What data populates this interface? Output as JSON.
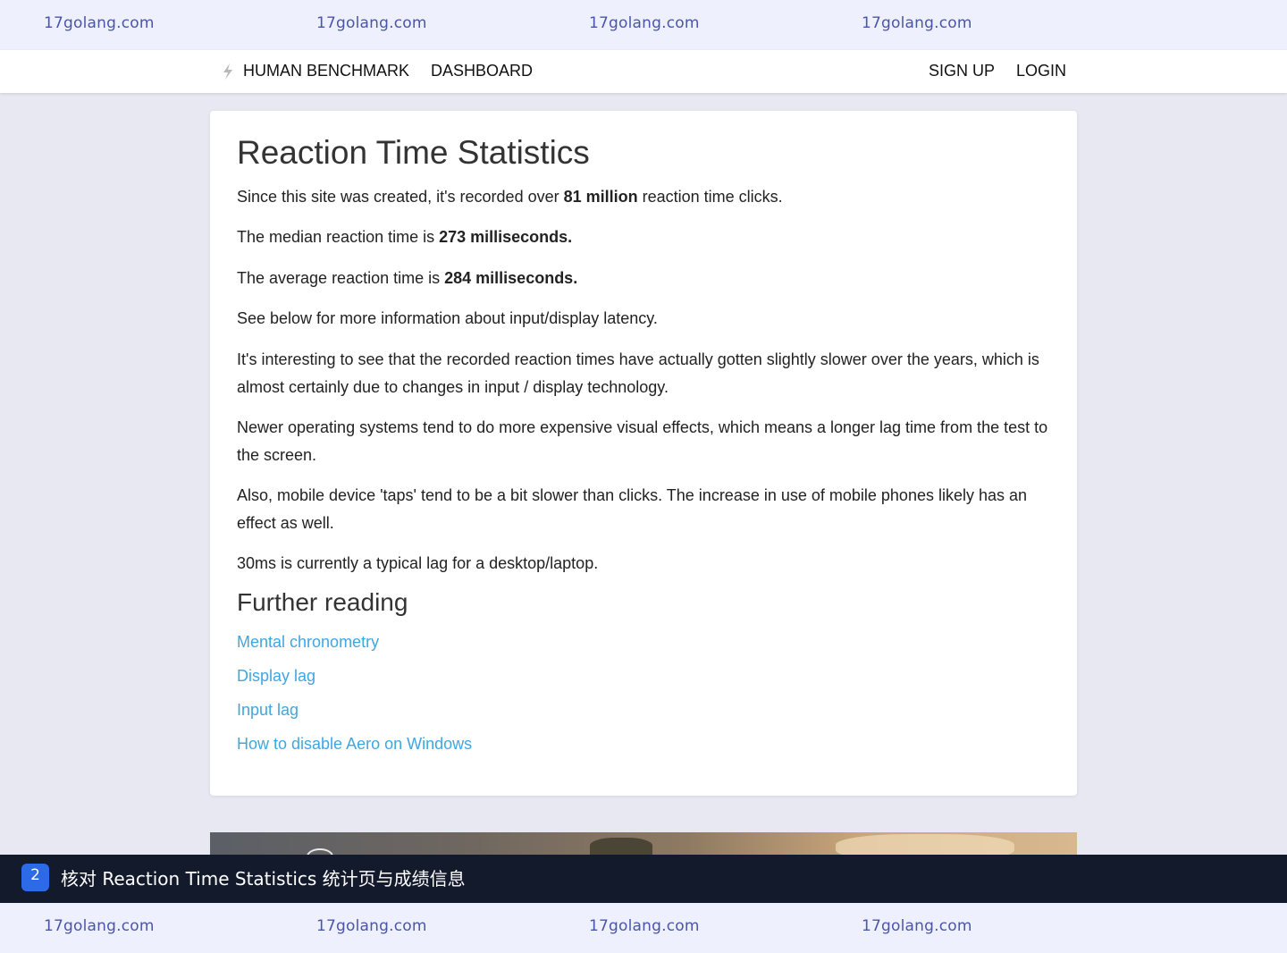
{
  "watermark": {
    "top": [
      "17golang.com",
      "17golang.com",
      "17golang.com",
      "17golang.com"
    ],
    "bottom": [
      "17golang.com",
      "17golang.com",
      "17golang.com",
      "17golang.com"
    ]
  },
  "nav": {
    "brand": "HUMAN BENCHMARK",
    "dashboard": "DASHBOARD",
    "signup": "SIGN UP",
    "login": "LOGIN",
    "brand_icon": "lightning-bolt-icon"
  },
  "content": {
    "title": "Reaction Time Statistics",
    "p1": {
      "before": "Since this site was created, it's recorded over ",
      "bold": "81 million",
      "after": " reaction time clicks."
    },
    "p2": {
      "before": "The median reaction time is ",
      "bold": "273 milliseconds."
    },
    "p3": {
      "before": "The average reaction time is ",
      "bold": "284 milliseconds."
    },
    "p4": "See below for more information about input/display latency.",
    "p5": "It's interesting to see that the recorded reaction times have actually gotten slightly slower over the years, which is almost certainly due to changes in input / display technology.",
    "p6": "Newer operating systems tend to do more expensive visual effects, which means a longer lag time from the test to the screen.",
    "p7": "Also, mobile device 'taps' tend to be a bit slower than clicks. The increase in use of mobile phones likely has an effect as well.",
    "p8": "30ms is currently a typical lag for a desktop/laptop.",
    "further_title": "Further reading",
    "links": [
      "Mental chronometry",
      "Display lag",
      "Input lag",
      "How to disable Aero on Windows"
    ]
  },
  "task": {
    "number": "2",
    "text": "核对 Reaction Time Statistics 统计页与成绩信息"
  },
  "colors": {
    "link": "#3fa6e0",
    "watermark_text": "#4a55a8",
    "task_badge": "#2c6ae8",
    "task_bar": "#131a2c"
  }
}
